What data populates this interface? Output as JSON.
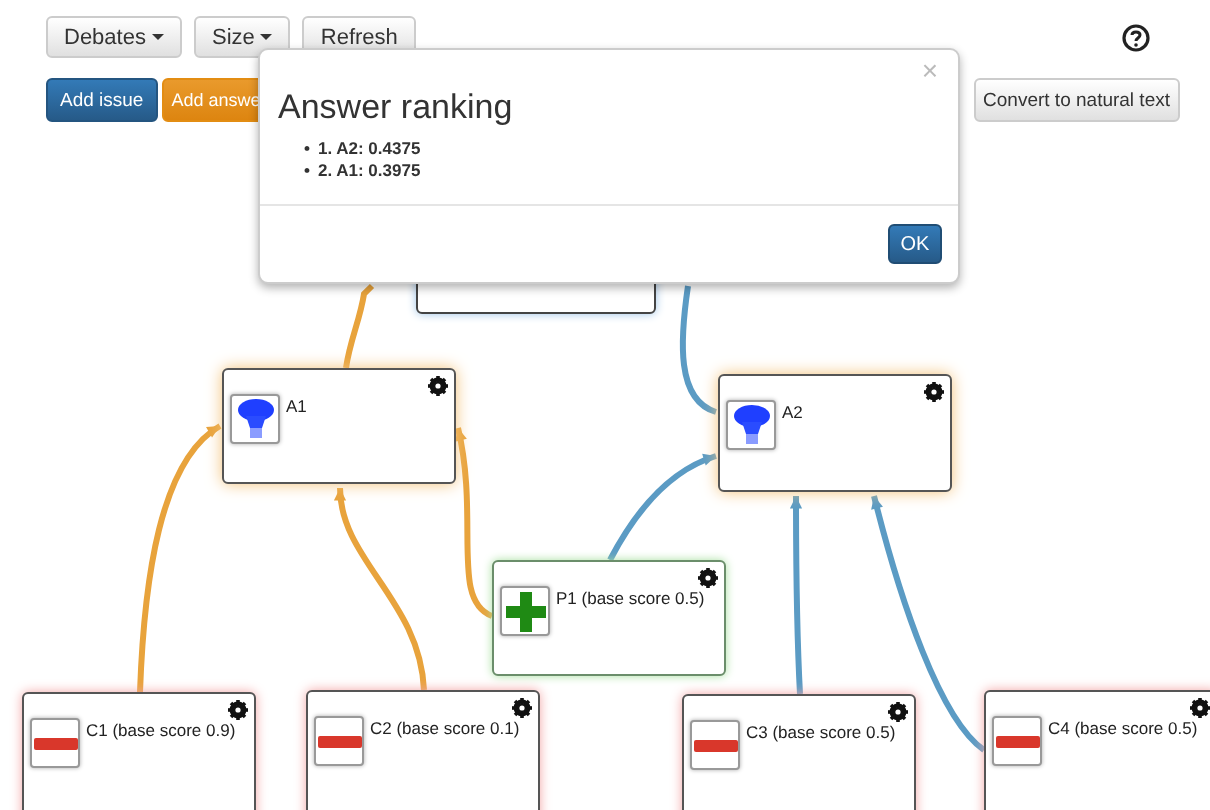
{
  "toolbar": {
    "menus": [
      {
        "label": "Debates",
        "caret": true
      },
      {
        "label": "Size",
        "caret": true
      },
      {
        "label": "Refresh",
        "caret": false
      }
    ],
    "actions": [
      {
        "label": "Add issue",
        "kind": "primary"
      },
      {
        "label": "Add answe",
        "kind": "warning"
      }
    ],
    "convert_button": "Convert to natural text"
  },
  "graph": {
    "nodes": [
      {
        "kind": "issue"
      },
      {
        "kind": "answer",
        "label": "A1"
      },
      {
        "kind": "answer",
        "label": "A2"
      },
      {
        "kind": "pro",
        "label": "P1 (base score 0.5)"
      },
      {
        "kind": "con",
        "label": "C1 (base score 0.9)"
      },
      {
        "kind": "con",
        "label": "C2 (base score 0.1)"
      },
      {
        "kind": "con",
        "label": "C3 (base score 0.5)"
      },
      {
        "kind": "con",
        "label": "C4 (base score 0.5)"
      }
    ],
    "edges": [
      {
        "color": "#e8a33c"
      },
      {
        "color": "#5b9bc4"
      },
      {
        "color": "#e8a33c"
      },
      {
        "color": "#e8a33c"
      },
      {
        "color": "#e8a33c"
      },
      {
        "color": "#5b9bc4"
      },
      {
        "color": "#5b9bc4"
      },
      {
        "color": "#5b9bc4"
      }
    ]
  },
  "dialog": {
    "title": "Answer ranking",
    "close": "×",
    "bullet": "•",
    "items": [
      "1. A2: 0.4375",
      "2. A1: 0.3975"
    ],
    "ok": "OK"
  }
}
